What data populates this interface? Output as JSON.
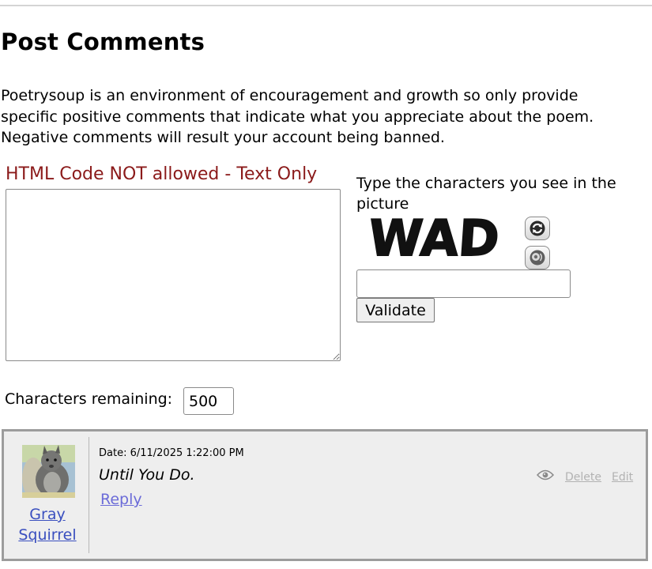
{
  "header": {
    "title": "Post Comments"
  },
  "intro": {
    "text": "Poetrysoup is an environment of encouragement and growth so only provide specific positive comments that indicate what you appreciate about the poem. Negative comments will result your account being banned."
  },
  "comment_form": {
    "code_note": "HTML Code NOT allowed - Text Only",
    "comment_value": "",
    "chars_remaining_label": "Characters remaining:",
    "chars_remaining_value": "500"
  },
  "captcha": {
    "label": "Type the characters you see in the picture",
    "image_text": "WAD",
    "refresh_icon": "refresh-icon",
    "audio_icon": "speaker-icon",
    "input_value": "",
    "validate_label": "Validate"
  },
  "comments": [
    {
      "author": "Gray Squirrel",
      "date": "Date: 6/11/2025 1:22:00 PM",
      "text": "Until You Do.",
      "reply_label": "Reply",
      "view_icon": "eye-icon",
      "delete_label": "Delete",
      "edit_label": "Edit"
    }
  ],
  "colors": {
    "note_red": "#8b1a1a",
    "link_blue": "#3a4fbf",
    "reply_blue": "#6b6bd8",
    "card_background": "#eeeeee",
    "muted_link": "#b2b2b2"
  }
}
